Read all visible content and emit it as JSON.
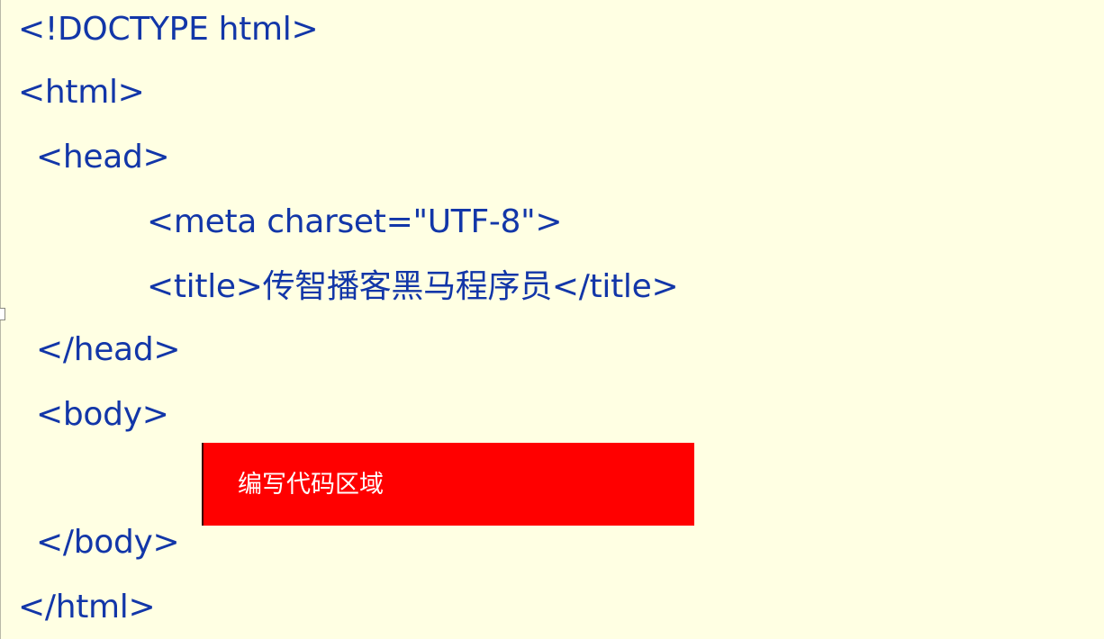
{
  "code_lines": [
    "<!DOCTYPE html>",
    "<html>",
    "<head>",
    "<meta charset=\"UTF-8\">",
    "<title>传智播客黑马程序员</title>",
    "</head>",
    "<body>",
    "</body>",
    "</html>"
  ],
  "code_area": {
    "label": "编写代码区域"
  },
  "colors": {
    "background": "#ffffe3",
    "code_text": "#1236a8",
    "code_area_fill": "#ff0000",
    "code_area_text": "#ffffff"
  }
}
